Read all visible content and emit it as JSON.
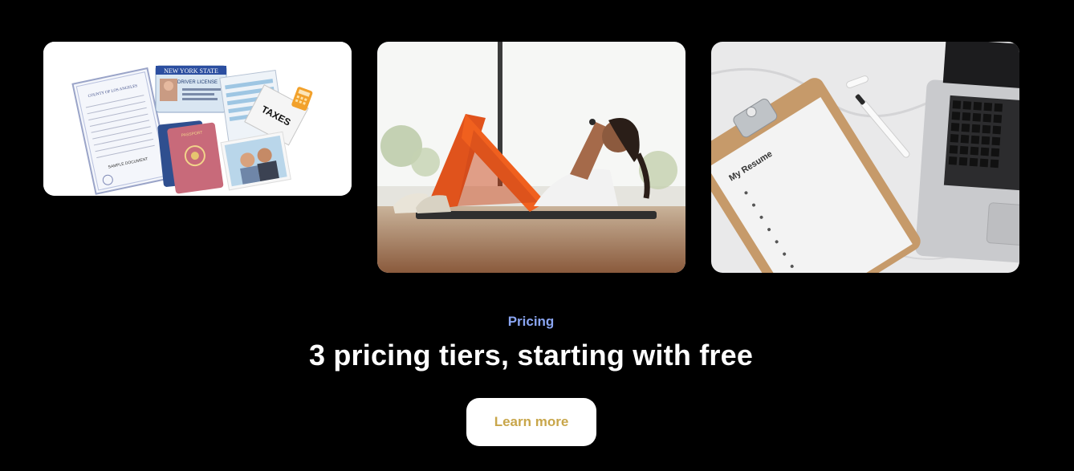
{
  "cards": [
    {
      "id": "documents",
      "image": "documents-collage",
      "texts": {
        "county": "COUNTY OF LOS ANGELES",
        "sample": "SAMPLE DOCUMENT",
        "state": "NEW YORK STATE",
        "license": "DRIVER LICENSE",
        "taxes": "TAXES",
        "passport": "PASSPORT"
      }
    },
    {
      "id": "fitness",
      "image": "woman-doing-crunches"
    },
    {
      "id": "resume",
      "image": "resume-clipboard-laptop",
      "texts": {
        "resume_title": "My Resume"
      }
    }
  ],
  "pricing": {
    "eyebrow": "Pricing",
    "headline": "3 pricing tiers, starting with free",
    "cta_label": "Learn more"
  },
  "colors": {
    "background": "#000000",
    "eyebrow": "#8aa5f2",
    "headline": "#ffffff",
    "cta_bg": "#ffffff",
    "cta_text": "#c8a64a"
  }
}
